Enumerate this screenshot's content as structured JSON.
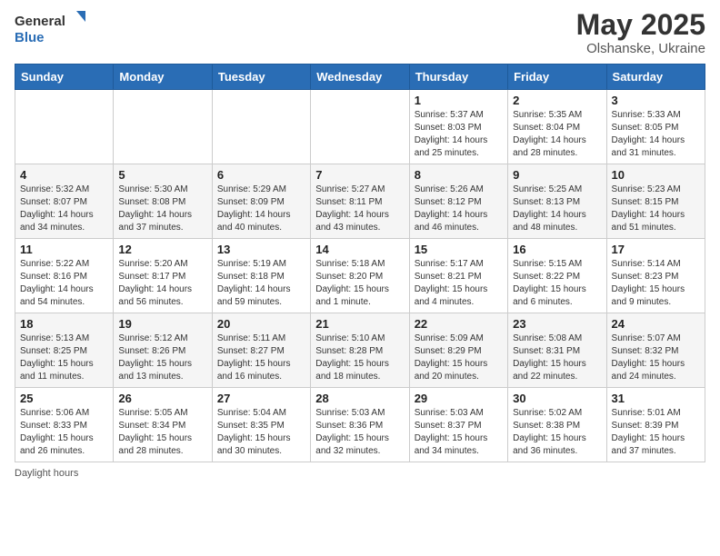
{
  "logo": {
    "general": "General",
    "blue": "Blue"
  },
  "title": "May 2025",
  "subtitle": "Olshanske, Ukraine",
  "days_of_week": [
    "Sunday",
    "Monday",
    "Tuesday",
    "Wednesday",
    "Thursday",
    "Friday",
    "Saturday"
  ],
  "weeks": [
    [
      {
        "day": "",
        "sunrise": "",
        "sunset": "",
        "daylight": ""
      },
      {
        "day": "",
        "sunrise": "",
        "sunset": "",
        "daylight": ""
      },
      {
        "day": "",
        "sunrise": "",
        "sunset": "",
        "daylight": ""
      },
      {
        "day": "",
        "sunrise": "",
        "sunset": "",
        "daylight": ""
      },
      {
        "day": "1",
        "sunrise": "Sunrise: 5:37 AM",
        "sunset": "Sunset: 8:03 PM",
        "daylight": "Daylight: 14 hours and 25 minutes."
      },
      {
        "day": "2",
        "sunrise": "Sunrise: 5:35 AM",
        "sunset": "Sunset: 8:04 PM",
        "daylight": "Daylight: 14 hours and 28 minutes."
      },
      {
        "day": "3",
        "sunrise": "Sunrise: 5:33 AM",
        "sunset": "Sunset: 8:05 PM",
        "daylight": "Daylight: 14 hours and 31 minutes."
      }
    ],
    [
      {
        "day": "4",
        "sunrise": "Sunrise: 5:32 AM",
        "sunset": "Sunset: 8:07 PM",
        "daylight": "Daylight: 14 hours and 34 minutes."
      },
      {
        "day": "5",
        "sunrise": "Sunrise: 5:30 AM",
        "sunset": "Sunset: 8:08 PM",
        "daylight": "Daylight: 14 hours and 37 minutes."
      },
      {
        "day": "6",
        "sunrise": "Sunrise: 5:29 AM",
        "sunset": "Sunset: 8:09 PM",
        "daylight": "Daylight: 14 hours and 40 minutes."
      },
      {
        "day": "7",
        "sunrise": "Sunrise: 5:27 AM",
        "sunset": "Sunset: 8:11 PM",
        "daylight": "Daylight: 14 hours and 43 minutes."
      },
      {
        "day": "8",
        "sunrise": "Sunrise: 5:26 AM",
        "sunset": "Sunset: 8:12 PM",
        "daylight": "Daylight: 14 hours and 46 minutes."
      },
      {
        "day": "9",
        "sunrise": "Sunrise: 5:25 AM",
        "sunset": "Sunset: 8:13 PM",
        "daylight": "Daylight: 14 hours and 48 minutes."
      },
      {
        "day": "10",
        "sunrise": "Sunrise: 5:23 AM",
        "sunset": "Sunset: 8:15 PM",
        "daylight": "Daylight: 14 hours and 51 minutes."
      }
    ],
    [
      {
        "day": "11",
        "sunrise": "Sunrise: 5:22 AM",
        "sunset": "Sunset: 8:16 PM",
        "daylight": "Daylight: 14 hours and 54 minutes."
      },
      {
        "day": "12",
        "sunrise": "Sunrise: 5:20 AM",
        "sunset": "Sunset: 8:17 PM",
        "daylight": "Daylight: 14 hours and 56 minutes."
      },
      {
        "day": "13",
        "sunrise": "Sunrise: 5:19 AM",
        "sunset": "Sunset: 8:18 PM",
        "daylight": "Daylight: 14 hours and 59 minutes."
      },
      {
        "day": "14",
        "sunrise": "Sunrise: 5:18 AM",
        "sunset": "Sunset: 8:20 PM",
        "daylight": "Daylight: 15 hours and 1 minute."
      },
      {
        "day": "15",
        "sunrise": "Sunrise: 5:17 AM",
        "sunset": "Sunset: 8:21 PM",
        "daylight": "Daylight: 15 hours and 4 minutes."
      },
      {
        "day": "16",
        "sunrise": "Sunrise: 5:15 AM",
        "sunset": "Sunset: 8:22 PM",
        "daylight": "Daylight: 15 hours and 6 minutes."
      },
      {
        "day": "17",
        "sunrise": "Sunrise: 5:14 AM",
        "sunset": "Sunset: 8:23 PM",
        "daylight": "Daylight: 15 hours and 9 minutes."
      }
    ],
    [
      {
        "day": "18",
        "sunrise": "Sunrise: 5:13 AM",
        "sunset": "Sunset: 8:25 PM",
        "daylight": "Daylight: 15 hours and 11 minutes."
      },
      {
        "day": "19",
        "sunrise": "Sunrise: 5:12 AM",
        "sunset": "Sunset: 8:26 PM",
        "daylight": "Daylight: 15 hours and 13 minutes."
      },
      {
        "day": "20",
        "sunrise": "Sunrise: 5:11 AM",
        "sunset": "Sunset: 8:27 PM",
        "daylight": "Daylight: 15 hours and 16 minutes."
      },
      {
        "day": "21",
        "sunrise": "Sunrise: 5:10 AM",
        "sunset": "Sunset: 8:28 PM",
        "daylight": "Daylight: 15 hours and 18 minutes."
      },
      {
        "day": "22",
        "sunrise": "Sunrise: 5:09 AM",
        "sunset": "Sunset: 8:29 PM",
        "daylight": "Daylight: 15 hours and 20 minutes."
      },
      {
        "day": "23",
        "sunrise": "Sunrise: 5:08 AM",
        "sunset": "Sunset: 8:31 PM",
        "daylight": "Daylight: 15 hours and 22 minutes."
      },
      {
        "day": "24",
        "sunrise": "Sunrise: 5:07 AM",
        "sunset": "Sunset: 8:32 PM",
        "daylight": "Daylight: 15 hours and 24 minutes."
      }
    ],
    [
      {
        "day": "25",
        "sunrise": "Sunrise: 5:06 AM",
        "sunset": "Sunset: 8:33 PM",
        "daylight": "Daylight: 15 hours and 26 minutes."
      },
      {
        "day": "26",
        "sunrise": "Sunrise: 5:05 AM",
        "sunset": "Sunset: 8:34 PM",
        "daylight": "Daylight: 15 hours and 28 minutes."
      },
      {
        "day": "27",
        "sunrise": "Sunrise: 5:04 AM",
        "sunset": "Sunset: 8:35 PM",
        "daylight": "Daylight: 15 hours and 30 minutes."
      },
      {
        "day": "28",
        "sunrise": "Sunrise: 5:03 AM",
        "sunset": "Sunset: 8:36 PM",
        "daylight": "Daylight: 15 hours and 32 minutes."
      },
      {
        "day": "29",
        "sunrise": "Sunrise: 5:03 AM",
        "sunset": "Sunset: 8:37 PM",
        "daylight": "Daylight: 15 hours and 34 minutes."
      },
      {
        "day": "30",
        "sunrise": "Sunrise: 5:02 AM",
        "sunset": "Sunset: 8:38 PM",
        "daylight": "Daylight: 15 hours and 36 minutes."
      },
      {
        "day": "31",
        "sunrise": "Sunrise: 5:01 AM",
        "sunset": "Sunset: 8:39 PM",
        "daylight": "Daylight: 15 hours and 37 minutes."
      }
    ]
  ],
  "footer": "Daylight hours"
}
